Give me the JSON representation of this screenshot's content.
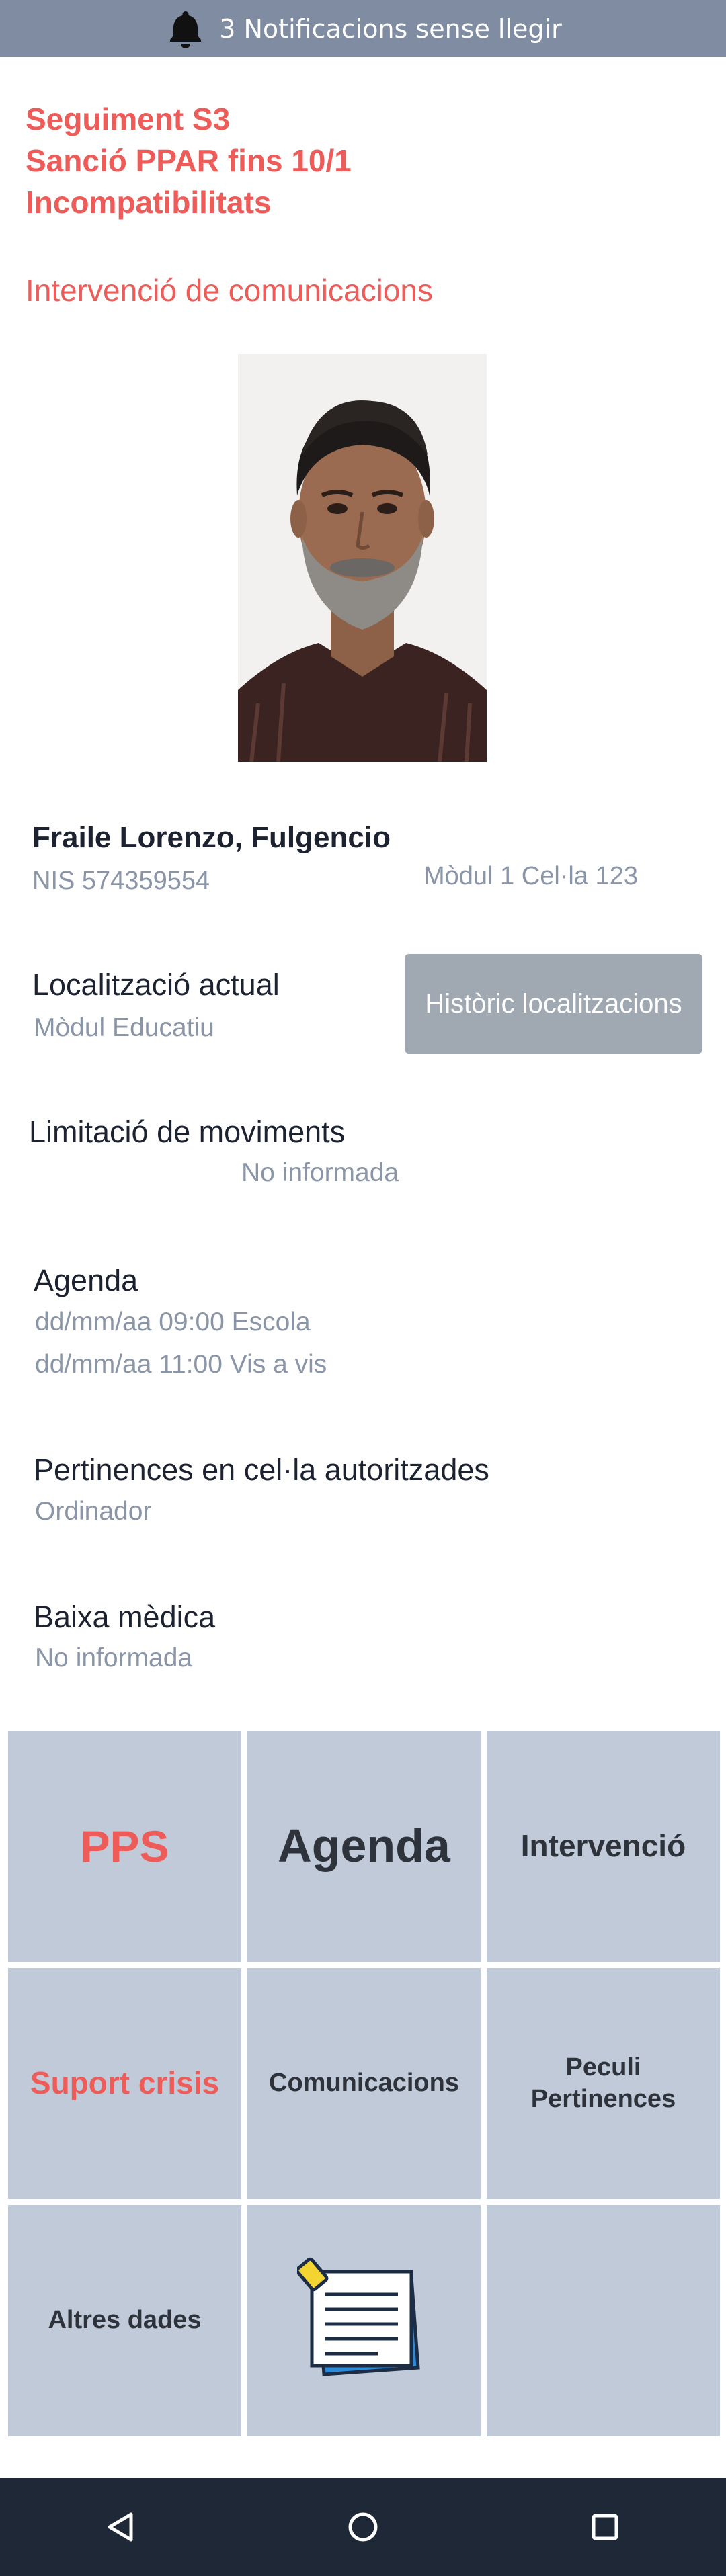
{
  "notification": {
    "icon": "bell-icon",
    "text": "3 Notificacions sense llegir"
  },
  "alerts": [
    "Seguiment S3",
    "Sanció PPAR fins 10/1",
    "Incompatibilitats"
  ],
  "intervention_alert": "Intervenció de comunicacions",
  "inmate": {
    "name": "Fraile Lorenzo, Fulgencio",
    "nis": "NIS 574359554",
    "module_cell": "Mòdul 1 Cel·la 123"
  },
  "location": {
    "label": "Localització actual",
    "value": "Mòdul Educatiu",
    "history_button": "Històric localitzacions"
  },
  "movement_limit": {
    "label": "Limitació de moviments",
    "value": "No informada"
  },
  "agenda": {
    "label": "Agenda",
    "items": [
      "dd/mm/aa 09:00 Escola",
      "dd/mm/aa 11:00 Vis a vis"
    ]
  },
  "belongings": {
    "label": "Pertinences en cel·la autoritzades",
    "value": "Ordinador"
  },
  "medical_leave": {
    "label": "Baixa mèdica",
    "value": "No informada"
  },
  "tiles": {
    "pps": "PPS",
    "agenda": "Agenda",
    "intervencio": "Intervenció",
    "suport_crisis": "Suport crisis",
    "comunicacions": "Comunicacions",
    "peculi_1": "Peculi",
    "peculi_2": "Pertinences",
    "altres_dades": "Altres dades",
    "notes_icon": "notepad-icon"
  },
  "colors": {
    "alert": "#ee5c59",
    "tile": "#c0cad8",
    "topbar": "#7f8ca1",
    "navbar": "#1f2836"
  },
  "navbar": {
    "back": "back-triangle-icon",
    "home": "home-circle-icon",
    "recents": "recents-square-icon"
  }
}
